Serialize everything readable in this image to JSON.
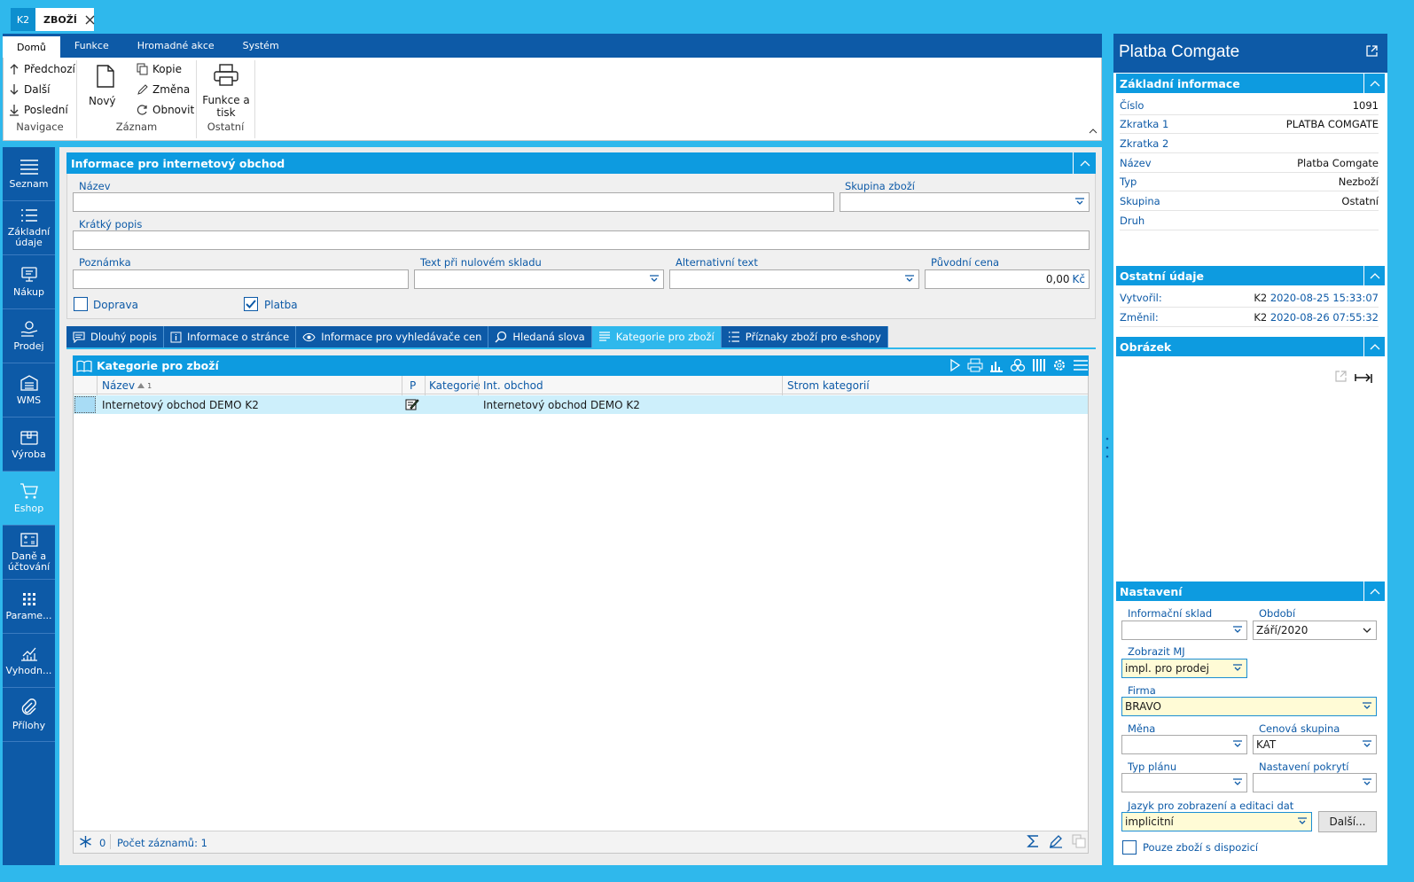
{
  "app": {
    "k2_tab": "K2",
    "doc_tab": "ZBOŽÍ"
  },
  "ribbon": {
    "tabs": [
      "Domů",
      "Funkce",
      "Hromadné akce",
      "Systém"
    ],
    "nav": {
      "prev": "Předchozí",
      "next": "Další",
      "last": "Poslední",
      "group": "Navigace"
    },
    "record": {
      "new": "Nový",
      "copy": "Kopie",
      "change": "Změna",
      "refresh": "Obnovit",
      "group": "Záznam"
    },
    "other": {
      "print": "Funkce a tisk",
      "group": "Ostatní"
    }
  },
  "sidebar": {
    "items": [
      {
        "label": "Seznam",
        "icon": "list-lines-icon"
      },
      {
        "label": "Základní údaje",
        "icon": "bullet-list-icon"
      },
      {
        "label": "Nákup",
        "icon": "monitor-cart-icon"
      },
      {
        "label": "Prodej",
        "icon": "hand-coins-icon"
      },
      {
        "label": "WMS",
        "icon": "warehouse-icon"
      },
      {
        "label": "Výroba",
        "icon": "box-icon"
      },
      {
        "label": "Eshop",
        "icon": "cart-icon"
      },
      {
        "label": "Daně a účtování",
        "icon": "calculator-icon"
      },
      {
        "label": "Parame...",
        "icon": "grid-dots-icon"
      },
      {
        "label": "Vyhodn...",
        "icon": "chart-icon"
      },
      {
        "label": "Přílohy",
        "icon": "paperclip-icon"
      }
    ],
    "active": "Eshop"
  },
  "eshop_info": {
    "title": "Informace pro internetový obchod",
    "name_label": "Název",
    "name_value": "",
    "group_label": "Skupina zboží",
    "group_value": "",
    "short_desc_label": "Krátký popis",
    "short_desc_value": "",
    "note_label": "Poznámka",
    "note_value": "",
    "zero_stock_label": "Text při nulovém skladu",
    "zero_stock_value": "",
    "alt_text_label": "Alternativní text",
    "alt_text_value": "",
    "orig_price_label": "Původní cena",
    "orig_price_value": "0,00",
    "currency": "Kč",
    "shipping_label": "Doprava",
    "shipping_checked": false,
    "payment_label": "Platba",
    "payment_checked": true
  },
  "bottom_tabs": [
    {
      "label": "Dlouhý popis",
      "icon": "comment-icon"
    },
    {
      "label": "Informace o stránce",
      "icon": "info-icon"
    },
    {
      "label": "Informace pro vyhledávače cen",
      "icon": "eye-icon"
    },
    {
      "label": "Hledaná slova",
      "icon": "search-icon"
    },
    {
      "label": "Kategorie pro zboží",
      "icon": "lines-icon",
      "active": true
    },
    {
      "label": "Příznaky zboží pro e-shopy",
      "icon": "bullet-list-icon"
    }
  ],
  "grid": {
    "title": "Kategorie pro zboží",
    "columns": {
      "name": "Název",
      "sort": "1",
      "p": "P",
      "category": "Kategorie",
      "shop": "Int. obchod",
      "tree": "Strom kategorií"
    },
    "rows": [
      {
        "name": "Internetový obchod DEMO K2",
        "category": "",
        "shop": "Internetový obchod DEMO K2",
        "tree": ""
      }
    ],
    "footer_count_zero": "0",
    "footer_records": "Počet záznamů: 1"
  },
  "right": {
    "title": "Platba Comgate",
    "basic": {
      "header": "Základní informace",
      "rows": [
        {
          "k": "Číslo",
          "v": "1091"
        },
        {
          "k": "Zkratka 1",
          "v": "PLATBA COMGATE"
        },
        {
          "k": "Zkratka 2",
          "v": ""
        },
        {
          "k": "Název",
          "v": "Platba Comgate"
        },
        {
          "k": "Typ",
          "v": "Nezboží"
        },
        {
          "k": "Skupina",
          "v": "Ostatní"
        },
        {
          "k": "Druh",
          "v": ""
        }
      ]
    },
    "other": {
      "header": "Ostatní údaje",
      "created_label": "Vytvořil:",
      "created_user": "K2",
      "created_date": "2020-08-25 15:33:07",
      "changed_label": "Změnil:",
      "changed_user": "K2",
      "changed_date": "2020-08-26 07:55:32"
    },
    "image": {
      "header": "Obrázek"
    },
    "settings": {
      "header": "Nastavení",
      "info_stock_label": "Informační sklad",
      "info_stock_value": "",
      "period_label": "Období",
      "period_value": "Září/2020",
      "unit_label": "Zobrazit MJ",
      "unit_value": "impl. pro prodej",
      "firm_label": "Firma",
      "firm_value": "BRAVO",
      "currency_label": "Měna",
      "currency_value": "",
      "price_group_label": "Cenová skupina",
      "price_group_value": "KAT",
      "plan_type_label": "Typ plánu",
      "plan_type_value": "",
      "coverage_label": "Nastavení pokrytí",
      "coverage_value": "",
      "lang_label": "Jazyk pro zobrazení a editaci dat",
      "lang_value": "implicitní",
      "more_button": "Další...",
      "only_available_label": "Pouze zboží s dispozicí",
      "only_available_checked": false
    }
  },
  "colors": {
    "accent": "#2fb8ec",
    "dark_blue": "#0d5aa7",
    "header_blue": "#0d9be0",
    "row_selected": "#cdeffb"
  }
}
